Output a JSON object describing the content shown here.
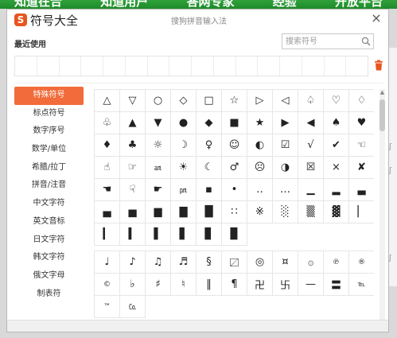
{
  "background": {
    "nav": [
      "知道在合",
      "知道用户",
      "答网专家",
      "经验",
      "开放平台"
    ],
    "side_text": [
      "ʃ",
      "ʃ",
      "ʃ"
    ]
  },
  "window": {
    "title": "符号大全",
    "subtitle": "搜狗拼音输入法",
    "logo_letter": "S",
    "close_symbol": "×"
  },
  "recent": {
    "label": "最近使用",
    "cells": 16
  },
  "search": {
    "placeholder": "搜索符号",
    "value": ""
  },
  "colors": {
    "accent": "#f26b3a",
    "logo": "#e8541d"
  },
  "icons": {
    "search": "search-icon",
    "trash": "trash-icon",
    "close": "close-icon"
  },
  "categories": [
    {
      "label": "特殊符号",
      "active": true
    },
    {
      "label": "标点符号",
      "active": false
    },
    {
      "label": "数字序号",
      "active": false
    },
    {
      "label": "数学/单位",
      "active": false
    },
    {
      "label": "希腊/拉丁",
      "active": false
    },
    {
      "label": "拼音/注音",
      "active": false
    },
    {
      "label": "中文字符",
      "active": false
    },
    {
      "label": "英文音标",
      "active": false
    },
    {
      "label": "日文字符",
      "active": false
    },
    {
      "label": "韩文字符",
      "active": false
    },
    {
      "label": "俄文字母",
      "active": false
    },
    {
      "label": "制表符",
      "active": false
    }
  ],
  "grid1": [
    [
      "△",
      "▽",
      "○",
      "◇",
      "□",
      "☆",
      "▷",
      "◁",
      "♤",
      "♡",
      "♢",
      "♧"
    ],
    [
      "▲",
      "▼",
      "●",
      "◆",
      "■",
      "★",
      "▶",
      "◀",
      "♠",
      "♥",
      "♦",
      "♣"
    ],
    [
      "☼",
      "☽",
      "♀",
      "☺",
      "◐",
      "☑",
      "√",
      "✔",
      "☜",
      "☝",
      "☞",
      "㏂"
    ],
    [
      "☀",
      "☾",
      "♂",
      "☹",
      "◑",
      "☒",
      "×",
      "✘",
      "☚",
      "☟",
      "☛",
      "㏘"
    ],
    [
      "▪",
      "•",
      "‥",
      "…",
      "▁",
      "▂",
      "▃",
      "▄",
      "▅",
      "▆",
      "▇",
      "█"
    ],
    [
      "∷",
      "※",
      "░",
      "▒",
      "▓",
      "▏",
      "▎",
      "▍",
      "▌",
      "▋",
      "▊",
      "▉"
    ]
  ],
  "grid2": [
    [
      "♩",
      "♪",
      "♫",
      "♬",
      "§",
      "〼",
      "◎",
      "¤",
      "۞",
      "℗",
      "®",
      "©"
    ],
    [
      "♭",
      "♯",
      "♮",
      "‖",
      "¶",
      "卍",
      "卐",
      "—",
      "〓",
      "℡",
      "™",
      "㏇"
    ]
  ]
}
